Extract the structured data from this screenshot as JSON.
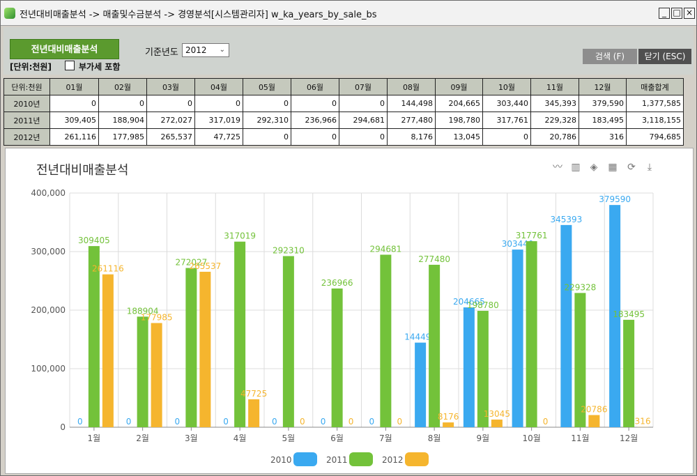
{
  "window": {
    "title": "전년대비매출분석 -> 매출및수금분석 -> 경영분석[시스템관리자] w_ka_years_by_sale_bs",
    "controls": [
      "_",
      "□",
      "×"
    ]
  },
  "toolbar": {
    "report_button": "전년대비매출분석",
    "unit_label": "[단위:천원]",
    "vat_label": "부가세 포함",
    "vat_checked": false,
    "year_label": "기준년도",
    "year_value": "2012",
    "search_button": "검색 (F)",
    "close_button": "닫기 (ESC)"
  },
  "table": {
    "headers": [
      "단위:천원",
      "01월",
      "02월",
      "03월",
      "04월",
      "05월",
      "06월",
      "07월",
      "08월",
      "09월",
      "10월",
      "11월",
      "12월",
      "매출합계"
    ],
    "rows": [
      {
        "label": "2010년",
        "cells": [
          "0",
          "0",
          "0",
          "0",
          "0",
          "0",
          "0",
          "144,498",
          "204,665",
          "303,440",
          "345,393",
          "379,590",
          "1,377,585"
        ]
      },
      {
        "label": "2011년",
        "cells": [
          "309,405",
          "188,904",
          "272,027",
          "317,019",
          "292,310",
          "236,966",
          "294,681",
          "277,480",
          "198,780",
          "317,761",
          "229,328",
          "183,495",
          "3,118,155"
        ]
      },
      {
        "label": "2012년",
        "cells": [
          "261,116",
          "177,985",
          "265,537",
          "47,725",
          "0",
          "0",
          "0",
          "8,176",
          "13,045",
          "0",
          "20,786",
          "316",
          "794,685"
        ]
      }
    ]
  },
  "chart_toolbar": {
    "icons": [
      "line-chart-icon",
      "bar-chart-icon",
      "stack-icon",
      "grid-icon",
      "refresh-icon",
      "download-icon"
    ]
  },
  "chart_data": {
    "type": "bar",
    "title": "전년대비매출분석",
    "categories": [
      "1월",
      "2월",
      "3월",
      "4월",
      "5월",
      "6월",
      "7월",
      "8월",
      "9월",
      "10월",
      "11월",
      "12월"
    ],
    "series": [
      {
        "name": "2010",
        "color": "#3aa9f0",
        "values": [
          0,
          0,
          0,
          0,
          0,
          0,
          0,
          144498,
          204665,
          303440,
          345393,
          379590
        ]
      },
      {
        "name": "2011",
        "color": "#73c23a",
        "values": [
          309405,
          188904,
          272027,
          317019,
          292310,
          236966,
          294681,
          277480,
          198780,
          317761,
          229328,
          183495
        ]
      },
      {
        "name": "2012",
        "color": "#f5b52e",
        "values": [
          261116,
          177985,
          265537,
          47725,
          0,
          0,
          0,
          8176,
          13045,
          0,
          20786,
          316
        ]
      }
    ],
    "yticks": [
      "0",
      "100,000",
      "200,000",
      "300,000",
      "400,000"
    ],
    "ylim": [
      0,
      400000
    ],
    "grid": true,
    "legend": "bottom-center"
  }
}
